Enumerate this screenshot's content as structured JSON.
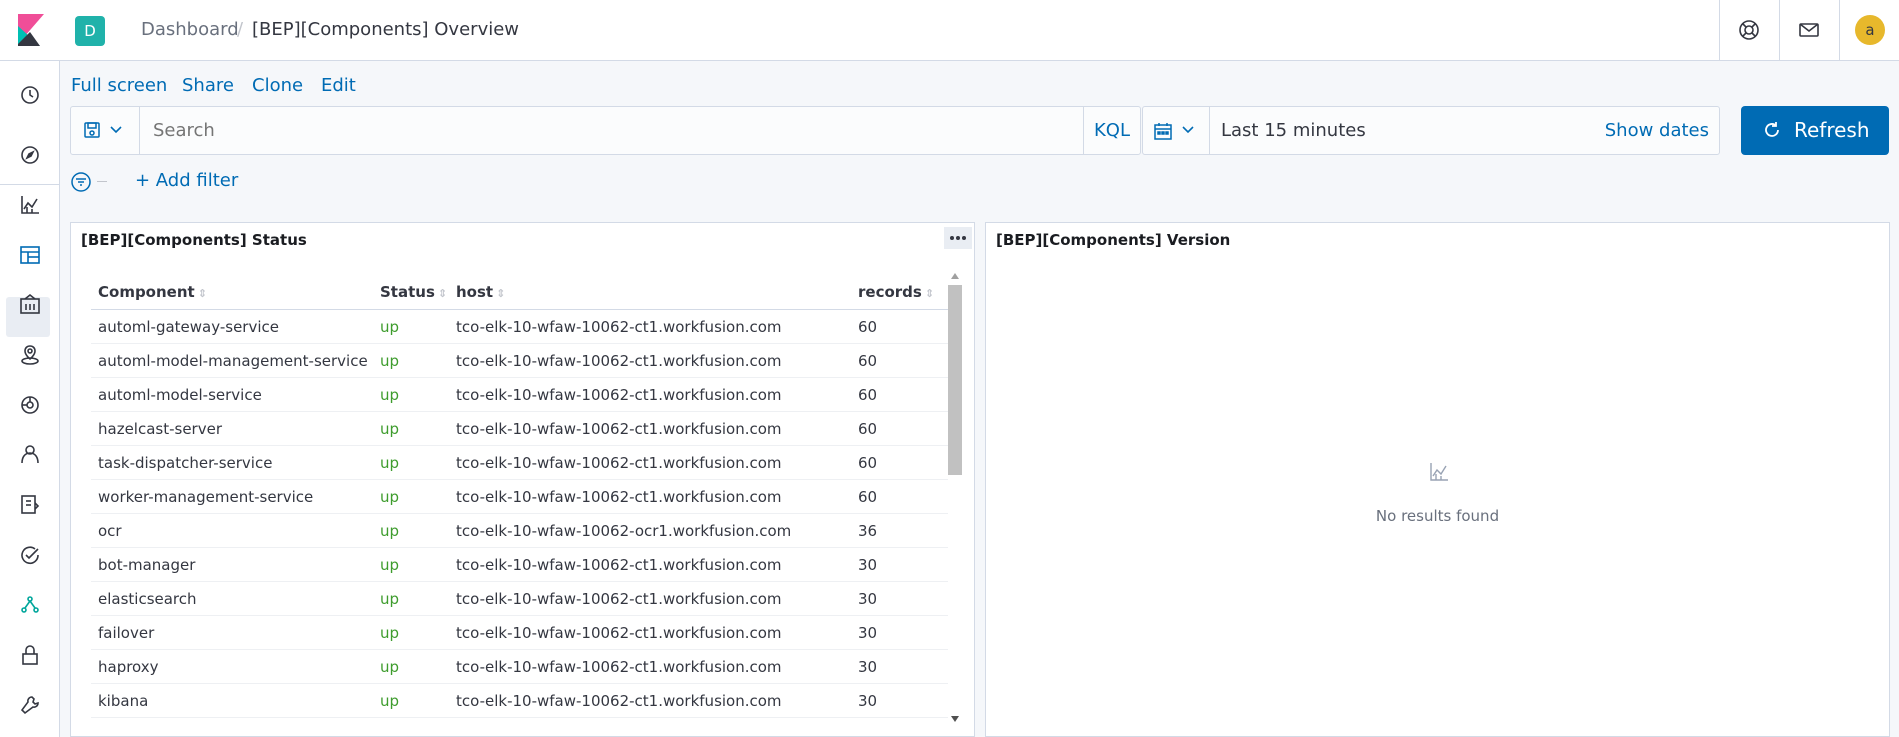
{
  "header": {
    "space_initial": "D",
    "breadcrumbs": [
      "Dashboard",
      "[BEP][Components] Overview"
    ],
    "breadcrumb_separator": "/",
    "user_initial": "a"
  },
  "toolbar": {
    "links": [
      "Full screen",
      "Share",
      "Clone",
      "Edit"
    ]
  },
  "query": {
    "placeholder": "Search",
    "language": "KQL"
  },
  "time": {
    "range": "Last 15 minutes",
    "show_dates": "Show dates",
    "refresh_label": "Refresh"
  },
  "filters": {
    "add_label": "+ Add filter"
  },
  "status_panel": {
    "title": "[BEP][Components] Status",
    "columns": [
      "Component",
      "Status",
      "host",
      "records"
    ],
    "rows": [
      [
        "automl-gateway-service",
        "up",
        "tco-elk-10-wfaw-10062-ct1.workfusion.com",
        "60"
      ],
      [
        "automl-model-management-service",
        "up",
        "tco-elk-10-wfaw-10062-ct1.workfusion.com",
        "60"
      ],
      [
        "automl-model-service",
        "up",
        "tco-elk-10-wfaw-10062-ct1.workfusion.com",
        "60"
      ],
      [
        "hazelcast-server",
        "up",
        "tco-elk-10-wfaw-10062-ct1.workfusion.com",
        "60"
      ],
      [
        "task-dispatcher-service",
        "up",
        "tco-elk-10-wfaw-10062-ct1.workfusion.com",
        "60"
      ],
      [
        "worker-management-service",
        "up",
        "tco-elk-10-wfaw-10062-ct1.workfusion.com",
        "60"
      ],
      [
        "ocr",
        "up",
        "tco-elk-10-wfaw-10062-ocr1.workfusion.com",
        "36"
      ],
      [
        "bot-manager",
        "up",
        "tco-elk-10-wfaw-10062-ct1.workfusion.com",
        "30"
      ],
      [
        "elasticsearch",
        "up",
        "tco-elk-10-wfaw-10062-ct1.workfusion.com",
        "30"
      ],
      [
        "failover",
        "up",
        "tco-elk-10-wfaw-10062-ct1.workfusion.com",
        "30"
      ],
      [
        "haproxy",
        "up",
        "tco-elk-10-wfaw-10062-ct1.workfusion.com",
        "30"
      ],
      [
        "kibana",
        "up",
        "tco-elk-10-wfaw-10062-ct1.workfusion.com",
        "30"
      ]
    ]
  },
  "version_panel": {
    "title": "[BEP][Components] Version",
    "empty_message": "No results found"
  },
  "colors": {
    "accent": "#006bb4",
    "status_up": "#3e9c2d",
    "space_badge": "#20b2aa",
    "avatar": "#e7b82c"
  },
  "icons": {
    "sidebar": [
      "clock-icon",
      "discover-compass-icon",
      "visualize-chart-icon",
      "dashboard-icon",
      "canvas-icon",
      "maps-icon",
      "ml-icon",
      "infrastructure-icon",
      "logs-icon",
      "uptime-icon",
      "graph-icon",
      "security-lock-icon",
      "dev-tools-wrench-icon"
    ],
    "header": [
      "help-lifebuoy-icon",
      "mail-icon"
    ]
  }
}
